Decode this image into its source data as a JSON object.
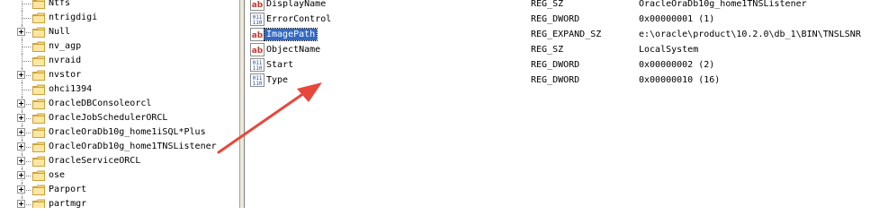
{
  "tree": {
    "items": [
      {
        "label": "Ntfs",
        "expandable": false
      },
      {
        "label": "ntrigdigi",
        "expandable": false
      },
      {
        "label": "Null",
        "expandable": true
      },
      {
        "label": "nv_agp",
        "expandable": false
      },
      {
        "label": "nvraid",
        "expandable": false
      },
      {
        "label": "nvstor",
        "expandable": true
      },
      {
        "label": "ohci1394",
        "expandable": false
      },
      {
        "label": "OracleDBConsoleorcl",
        "expandable": true
      },
      {
        "label": "OracleJobSchedulerORCL",
        "expandable": true
      },
      {
        "label": "OracleOraDb10g_home1iSQL*Plus",
        "expandable": true
      },
      {
        "label": "OracleOraDb10g_home1TNSListener",
        "expandable": true
      },
      {
        "label": "OracleServiceORCL",
        "expandable": true
      },
      {
        "label": "ose",
        "expandable": true
      },
      {
        "label": "Parport",
        "expandable": true
      },
      {
        "label": "partmgr",
        "expandable": true
      }
    ]
  },
  "values": {
    "rows": [
      {
        "name": "DisplayName",
        "type": "REG_SZ",
        "data": "OracleOraDb10g_home1TNSListener",
        "icon": "string-value-icon",
        "selected": false
      },
      {
        "name": "ErrorControl",
        "type": "REG_DWORD",
        "data": "0x00000001 (1)",
        "icon": "dword-value-icon",
        "selected": false
      },
      {
        "name": "ImagePath",
        "type": "REG_EXPAND_SZ",
        "data": "e:\\oracle\\product\\10.2.0\\db_1\\BIN\\TNSLSNR",
        "icon": "string-value-icon",
        "selected": true
      },
      {
        "name": "ObjectName",
        "type": "REG_SZ",
        "data": "LocalSystem",
        "icon": "string-value-icon",
        "selected": false
      },
      {
        "name": "Start",
        "type": "REG_DWORD",
        "data": "0x00000002 (2)",
        "icon": "dword-value-icon",
        "selected": false
      },
      {
        "name": "Type",
        "type": "REG_DWORD",
        "data": "0x00000010 (16)",
        "icon": "dword-value-icon",
        "selected": false
      }
    ]
  },
  "colors": {
    "selection": "#316ac5",
    "arrow": "#e8473c",
    "folder": "#f5d77a",
    "string_icon": "#c0392b",
    "dword_icon": "#1f4e9c"
  }
}
